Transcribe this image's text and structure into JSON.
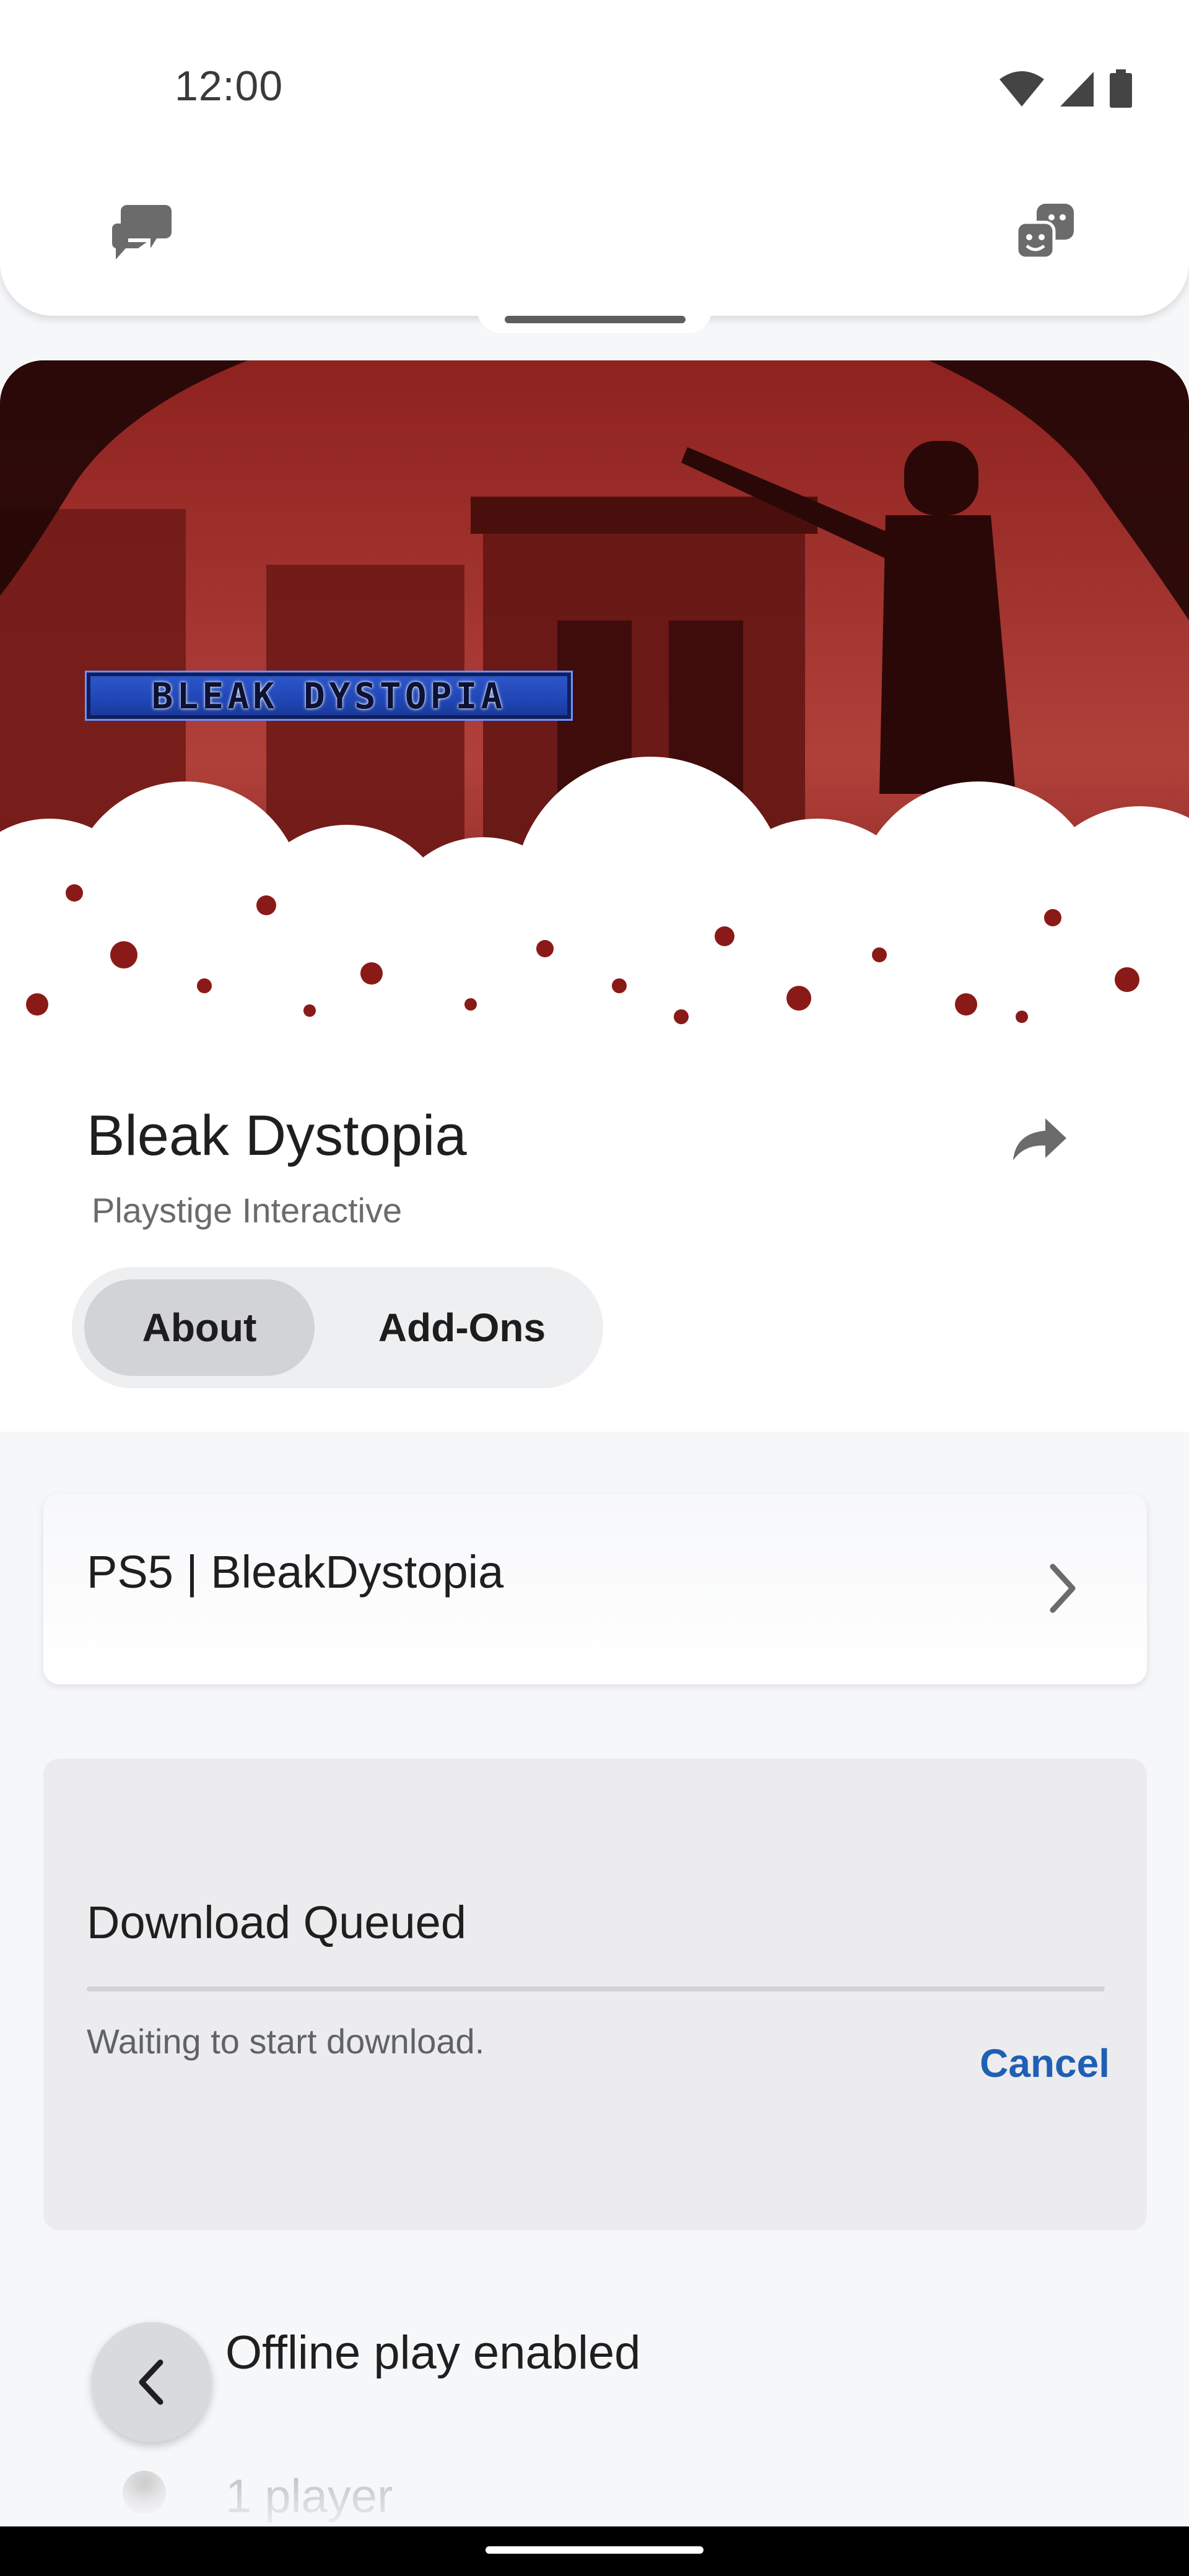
{
  "status_bar": {
    "time": "12:00",
    "icons": [
      "wifi-icon",
      "cellular-signal-icon",
      "battery-icon"
    ]
  },
  "top_nav": {
    "left_icon": "chat-bubbles-icon",
    "right_icon": "friends-faces-icon"
  },
  "hero": {
    "logo_text": "BLEAK DYSTOPIA",
    "colors": {
      "sky": "#9c2a26",
      "dark": "#3a0d0b",
      "clouds": "#ffffff"
    }
  },
  "game": {
    "title": "Bleak Dystopia",
    "publisher": "Playstige Interactive",
    "share_icon": "share-arrow-icon"
  },
  "tabs": [
    {
      "label": "About",
      "selected": true
    },
    {
      "label": "Add-Ons",
      "selected": false
    }
  ],
  "product": {
    "label": "PS5 | BleakDystopia",
    "icon": "chevron-right-icon"
  },
  "download": {
    "title": "Download Queued",
    "status": "Waiting to start download.",
    "cancel_label": "Cancel",
    "progress": 0,
    "accent": "#1f5fb5"
  },
  "features": [
    {
      "label": "Offline play enabled"
    },
    {
      "label": "1 player"
    }
  ],
  "back_button": {
    "icon": "chevron-left-icon"
  }
}
